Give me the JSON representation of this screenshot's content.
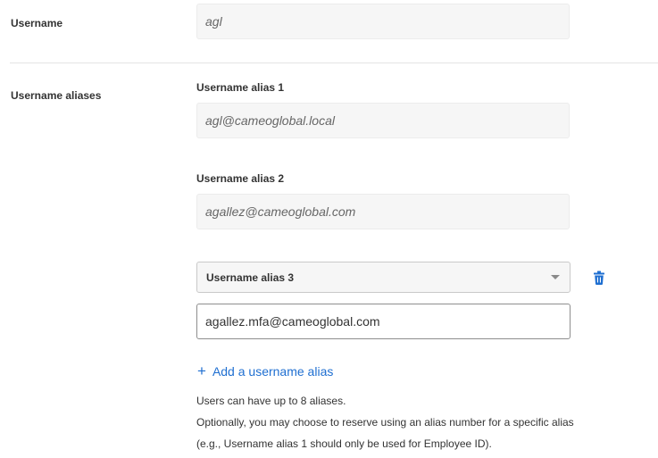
{
  "username": {
    "label": "Username",
    "value": "agl"
  },
  "aliases": {
    "label": "Username aliases",
    "alias1": {
      "label": "Username alias 1",
      "value": "agl@cameoglobal.local"
    },
    "alias2": {
      "label": "Username alias 2",
      "value": "agallez@cameoglobal.com"
    },
    "alias3": {
      "selected": "Username alias 3",
      "value": "agallez.mfa@cameoglobal.com",
      "delete_icon": "trash-icon"
    },
    "add_link": {
      "icon": "+",
      "label": "Add a username alias"
    },
    "help": {
      "line1": "Users can have up to 8 aliases.",
      "line2": "Optionally, you may choose to reserve using an alias number for a specific alias",
      "line3": "(e.g., Username alias 1 should only be used for Employee ID)."
    }
  },
  "colors": {
    "link": "#1f6fd1",
    "icon_blue": "#1f6fd1",
    "field_bg": "#f6f6f6"
  }
}
